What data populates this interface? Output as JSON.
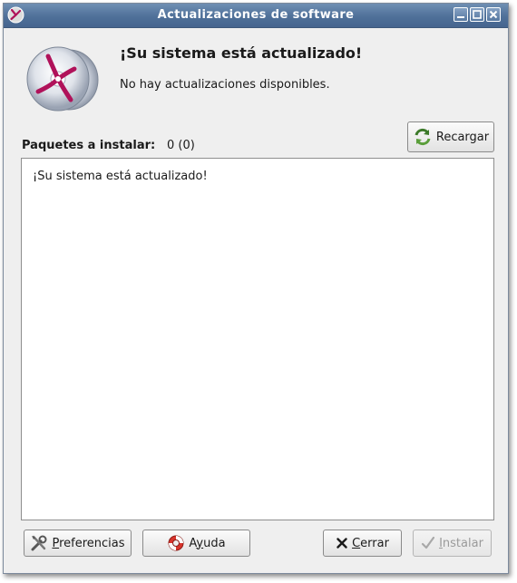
{
  "window": {
    "title": "Actualizaciones de software"
  },
  "header": {
    "heading": "¡Su sistema está actualizado!",
    "subheading": "No hay actualizaciones disponibles."
  },
  "packages": {
    "label": "Paquetes a instalar:",
    "count": "0 (0)"
  },
  "toolbar": {
    "reload_label": "Recargar"
  },
  "details": {
    "text": "¡Su sistema está actualizado!"
  },
  "buttons": {
    "preferences": {
      "mnemonic": "P",
      "rest": "referencias"
    },
    "help": {
      "mnemonic": "y",
      "prefix": "A",
      "rest": "uda"
    },
    "close": {
      "mnemonic": "C",
      "rest": "errar"
    },
    "install": {
      "mnemonic": "I",
      "rest": "nstalar"
    }
  },
  "icons": {
    "app": "software-update-icon",
    "reload": "reload-icon",
    "preferences": "tools-icon",
    "help": "lifebuoy-icon",
    "close": "x-icon",
    "install": "checkmark-icon"
  },
  "colors": {
    "titlebar": "#4f7099",
    "accent": "#b0125a",
    "disabled_text": "#9a9a9a"
  }
}
